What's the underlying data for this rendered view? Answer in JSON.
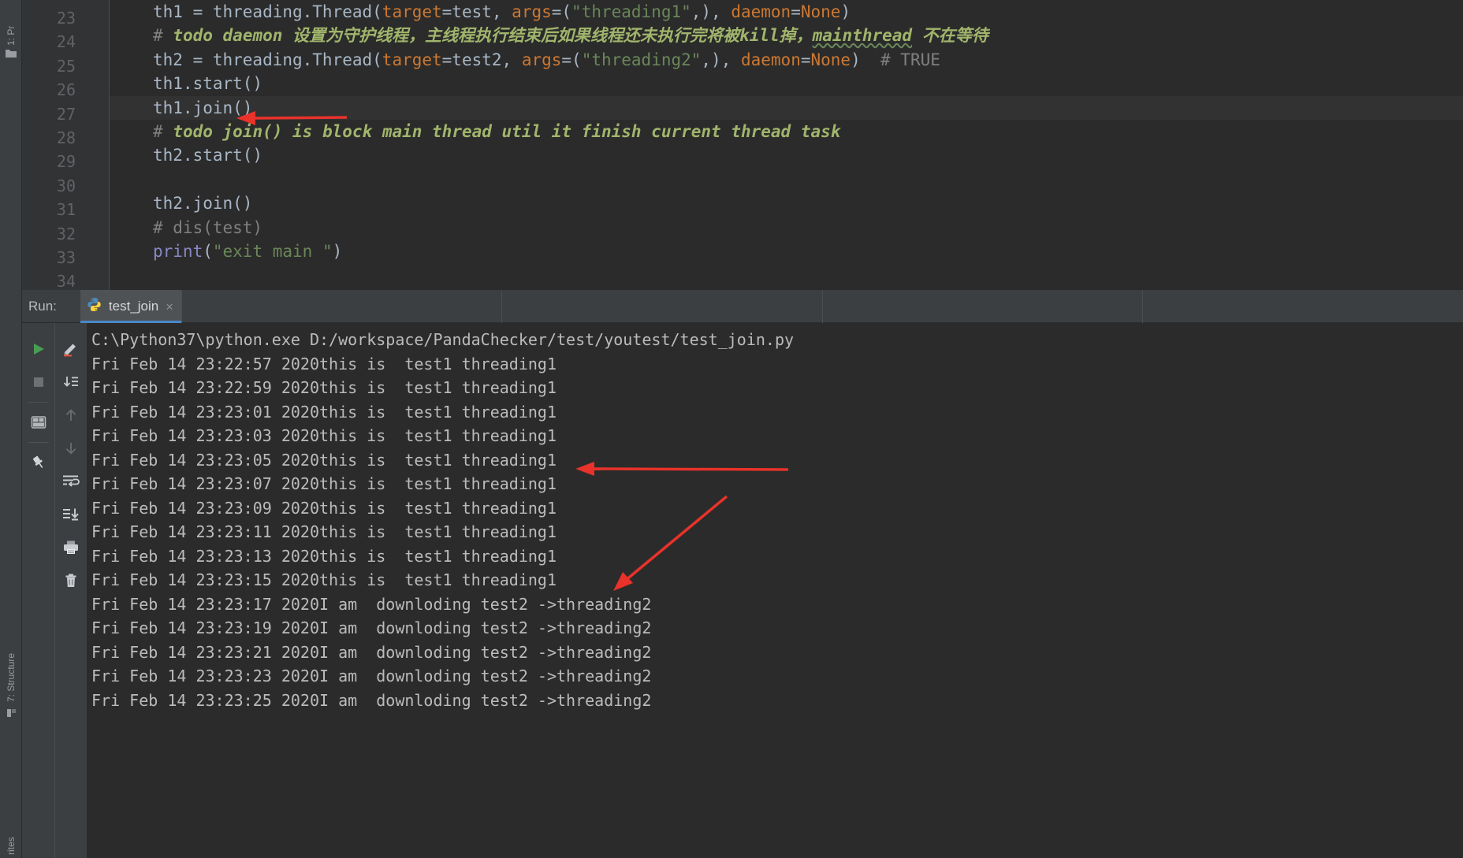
{
  "window": {
    "app": "PyCharm",
    "theme_bg": "#3c3f41",
    "editor_bg": "#2b2b2b",
    "accent": "#4a88c7",
    "annotation_color": "#e8322a"
  },
  "left_strip": {
    "top_label": "1: Pr",
    "structure_label": "7: Structure",
    "favorites_label": "rites",
    "project_icon": "folder-icon",
    "structure_icon": "structure-icon",
    "favorites_icon": "star-icon"
  },
  "editor": {
    "first_visible_line": 23,
    "lines": [
      {
        "num": "23",
        "html": "<span class=\"code-text\">th1 = threading.Thread(<span class=\"orange\">target</span>=test, <span class=\"orange\">args</span>=(<span class=\"str\">\"threading1\"</span>,), <span class=\"orange\">daemon</span>=<span class=\"kw\">None</span>)</span>"
      },
      {
        "num": "24",
        "html": "<span class=\"code-text\"><span class=\"cmt\">#</span> <span class=\"todo\">todo daemon</span> <span class=\"todo-cn\">设置为守护线程，主线程执行结束后如果线程还未执行完将被</span><span class=\"todo\">kill</span><span class=\"todo-cn\">掉，</span><span class=\"todo wavy\">mainthread</span> <span class=\"todo-cn\">不在等待</span></span>"
      },
      {
        "num": "25",
        "html": "<span class=\"code-text\">th2 = threading.Thread(<span class=\"orange\">target</span>=test2, <span class=\"orange\">args</span>=(<span class=\"str\">\"threading2\"</span>,), <span class=\"orange\">daemon</span>=<span class=\"kw\">None</span>)  <span class=\"cmt\"># TRUE</span></span>"
      },
      {
        "num": "26",
        "html": "<span class=\"code-text\">th1.start()</span>"
      },
      {
        "num": "27",
        "html": "<span class=\"code-text\">th1.join()</span>"
      },
      {
        "num": "28",
        "html": "<span class=\"code-text\"><span class=\"cmt\">#</span> <span class=\"todo\">todo join() is block main thread util it finish current thread task</span></span>"
      },
      {
        "num": "29",
        "html": "<span class=\"code-text\">th2.start()</span>"
      },
      {
        "num": "30",
        "html": "<span class=\"code-text\"></span>"
      },
      {
        "num": "31",
        "html": "<span class=\"code-text\">th2.join()</span>"
      },
      {
        "num": "32",
        "html": "<span class=\"code-text\"><span class=\"cmt\"># dis(test)</span></span>"
      },
      {
        "num": "33",
        "html": "<span class=\"code-text\"><span class=\"builtin\">print</span>(<span class=\"str\">\"exit main \"</span>)</span>"
      },
      {
        "num": "34",
        "html": "<span class=\"code-text\"></span>"
      }
    ],
    "plain_lines": [
      "th1 = threading.Thread(target=test, args=(\"threading1\",), daemon=None)",
      "# todo daemon 设置为守护线程，主线程执行结束后如果线程还未执行完将被kill掉，mainthread 不在等待",
      "th2 = threading.Thread(target=test2, args=(\"threading2\",), daemon=None)  # TRUE",
      "th1.start()",
      "th1.join()",
      "# todo join() is block main thread util it finish current thread task",
      "th2.start()",
      "",
      "th2.join()",
      "# dis(test)",
      "print(\"exit main \")",
      ""
    ]
  },
  "run_panel": {
    "label": "Run:",
    "tab": {
      "name": "test_join",
      "icon": "python-icon",
      "close": "✕"
    },
    "toolbar_primary": [
      {
        "name": "rerun-button",
        "icon": "play-icon"
      },
      {
        "name": "stop-button",
        "icon": "stop-icon"
      },
      {
        "name": "layout-button",
        "icon": "layout-icon"
      },
      {
        "name": "pin-button",
        "icon": "pin-icon"
      }
    ],
    "toolbar_secondary": [
      {
        "name": "edit-configuration-button",
        "icon": "pencil-icon"
      },
      {
        "name": "scroll-to-end-button",
        "icon": "scroll-to-end-icon"
      },
      {
        "name": "up-button",
        "icon": "arrow-up-icon"
      },
      {
        "name": "down-button",
        "icon": "arrow-down-icon"
      },
      {
        "name": "soft-wrap-button",
        "icon": "soft-wrap-icon"
      },
      {
        "name": "export-button",
        "icon": "export-icon"
      },
      {
        "name": "print-button",
        "icon": "print-icon"
      },
      {
        "name": "clear-all-button",
        "icon": "trash-icon"
      }
    ]
  },
  "console": {
    "command": "C:\\Python37\\python.exe D:/workspace/PandaChecker/test/youtest/test_join.py",
    "lines": [
      "C:\\Python37\\python.exe D:/workspace/PandaChecker/test/youtest/test_join.py",
      "Fri Feb 14 23:22:57 2020this is  test1 threading1",
      "Fri Feb 14 23:22:59 2020this is  test1 threading1",
      "Fri Feb 14 23:23:01 2020this is  test1 threading1",
      "Fri Feb 14 23:23:03 2020this is  test1 threading1",
      "Fri Feb 14 23:23:05 2020this is  test1 threading1",
      "Fri Feb 14 23:23:07 2020this is  test1 threading1",
      "Fri Feb 14 23:23:09 2020this is  test1 threading1",
      "Fri Feb 14 23:23:11 2020this is  test1 threading1",
      "Fri Feb 14 23:23:13 2020this is  test1 threading1",
      "Fri Feb 14 23:23:15 2020this is  test1 threading1",
      "Fri Feb 14 23:23:17 2020I am  downloding test2 ->threading2",
      "Fri Feb 14 23:23:19 2020I am  downloding test2 ->threading2",
      "Fri Feb 14 23:23:21 2020I am  downloding test2 ->threading2",
      "Fri Feb 14 23:23:23 2020I am  downloding test2 ->threading2",
      "Fri Feb 14 23:23:25 2020I am  downloding test2 ->threading2"
    ]
  },
  "annotations": [
    {
      "name": "arrow-to-join-call",
      "target": "th1.join()"
    },
    {
      "name": "arrow-to-test1-output",
      "target": "Fri Feb 14 23:23:05 2020this is  test1 threading1"
    },
    {
      "name": "arrow-to-test2-output",
      "target": "Fri Feb 14 23:23:15 2020this is  test1 threading1"
    }
  ]
}
